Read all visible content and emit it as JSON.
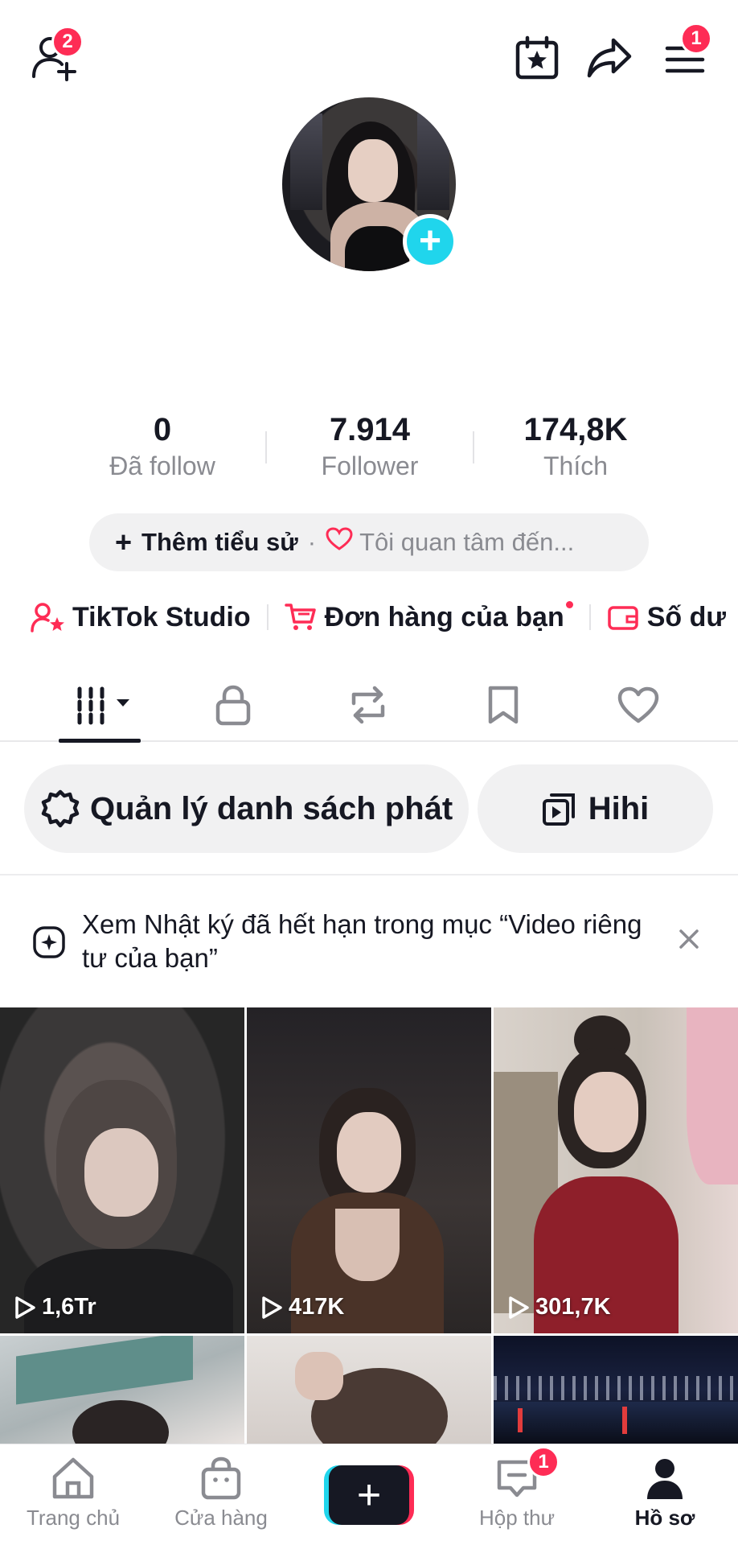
{
  "top_bar": {
    "add_friend_badge": "2",
    "menu_badge": "1",
    "icons": [
      "add-friend-icon",
      "calendar-star-icon",
      "share-icon",
      "menu-icon"
    ]
  },
  "profile": {
    "stats": [
      {
        "value": "0",
        "label": "Đã follow"
      },
      {
        "value": "7.914",
        "label": "Follower"
      },
      {
        "value": "174,8K",
        "label": "Thích"
      }
    ],
    "bio_add": "Thêm tiểu sử",
    "bio_separator": "·",
    "bio_interest": "Tôi quan tâm đến..."
  },
  "links": {
    "studio": "TikTok Studio",
    "orders": "Đơn hàng của bạn",
    "balance": "Số dư"
  },
  "tabs": [
    "grid-icon",
    "lock-icon",
    "repost-icon",
    "bookmark-icon",
    "heart-icon"
  ],
  "playlist": {
    "manage": "Quản lý danh sách phát",
    "playlist_name": "Hihi"
  },
  "notice": {
    "text": "Xem Nhật ký đã hết hạn trong mục “Video riêng tư của bạn”"
  },
  "videos": [
    {
      "views": "1,6Tr"
    },
    {
      "views": "417K"
    },
    {
      "views": "301,7K"
    },
    {
      "views": ""
    },
    {
      "views": ""
    },
    {
      "views": ""
    }
  ],
  "nav": {
    "home": "Trang chủ",
    "shop": "Cửa hàng",
    "create": "+",
    "inbox": "Hộp thư",
    "inbox_badge": "1",
    "profile": "Hồ sơ"
  },
  "colors": {
    "accent": "#fe2c55",
    "cyan": "#20d5ec",
    "text": "#161823",
    "muted": "#8a8b91"
  }
}
